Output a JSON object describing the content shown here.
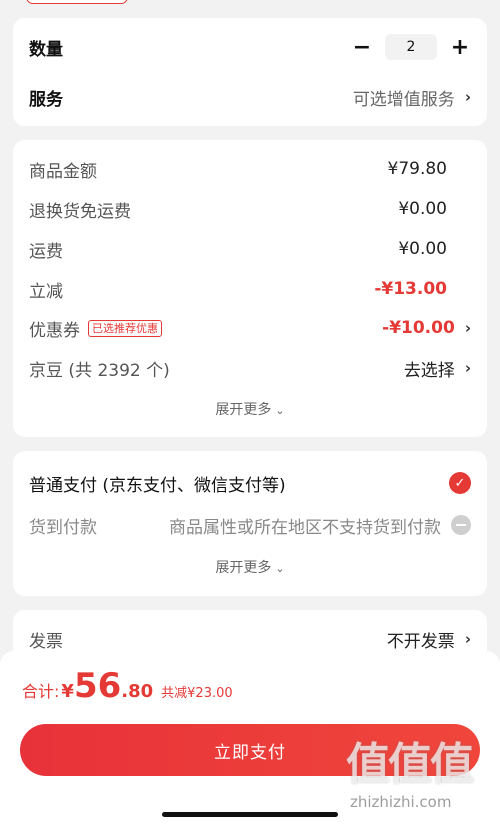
{
  "product_card": {
    "quantity_label": "数量",
    "quantity_value": "2",
    "minus_symbol": "−",
    "plus_symbol": "+",
    "service_label": "服务",
    "service_value": "可选增值服务"
  },
  "price_card": {
    "rows": [
      {
        "label": "商品金额",
        "value": "¥79.80"
      },
      {
        "label": "退换货免运费",
        "value": "¥0.00"
      },
      {
        "label": "运费",
        "value": "¥0.00"
      },
      {
        "label": "立减",
        "value": "-¥13.00"
      },
      {
        "label": "优惠券",
        "tag": "已选推荐优惠",
        "value": "-¥10.00"
      },
      {
        "label": "京豆 (共 2392 个)",
        "value": "去选择"
      }
    ],
    "expand_label": "展开更多"
  },
  "payment_card": {
    "normal_pay_label": "普通支付 (京东支付、微信支付等)",
    "cod_label": "货到付款",
    "cod_note": "商品属性或所在地区不支持货到付款",
    "expand_label": "展开更多"
  },
  "invoice_card": {
    "label": "发票",
    "value": "不开发票"
  },
  "bottom_bar": {
    "total_label": "合计:",
    "currency": "¥",
    "total_integer": "56",
    "total_decimal": ".80",
    "discount_text": "共减¥23.00",
    "pay_button_label": "立即支付"
  },
  "watermark": {
    "logo_text": "值值值",
    "site": "zhizhizhi.com"
  },
  "colors": {
    "accent": "#e53935",
    "background": "#f2f2f2"
  }
}
